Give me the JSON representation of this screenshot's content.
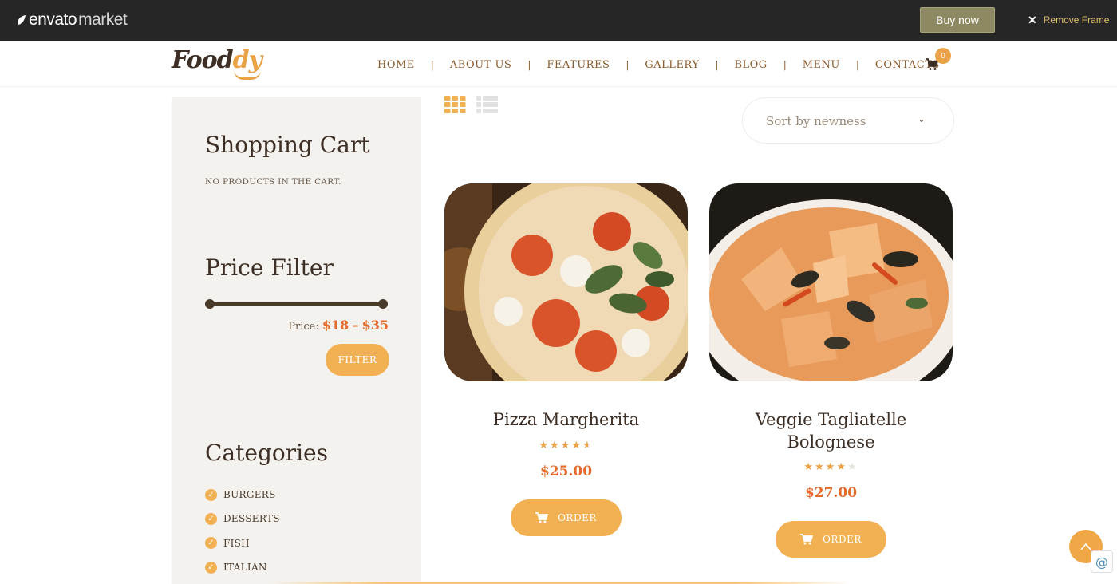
{
  "envato": {
    "brand": "envato",
    "brand_suffix": "market",
    "buy_now": "Buy now",
    "remove_frame": "Remove Frame"
  },
  "header": {
    "logo_text_a": "Food",
    "logo_text_b": "dy",
    "nav": [
      "HOME",
      "ABOUT US",
      "FEATURES",
      "GALLERY",
      "BLOG",
      "MENU",
      "CONTACTS"
    ],
    "nav_separator": "|",
    "cart_count": "0"
  },
  "sidebar": {
    "cart_title": "Shopping Cart",
    "cart_empty": "NO PRODUCTS IN THE CART.",
    "price_filter_title": "Price Filter",
    "price_label": "Price:",
    "price_min": "$18",
    "price_dash": "–",
    "price_max": "$35",
    "filter_button": "FILTER",
    "categories_title": "Categories",
    "categories": [
      "BURGERS",
      "DESSERTS",
      "FISH",
      "ITALIAN"
    ]
  },
  "toolbar": {
    "sort_label": "Sort by newness"
  },
  "products": [
    {
      "title_line1": "Pizza Margherita",
      "title_line2": "",
      "rating": 4.5,
      "price": "$25.00",
      "button": "ORDER"
    },
    {
      "title_line1": "Veggie Tagliatelle",
      "title_line2": "Bolognese",
      "rating": 4,
      "price": "$27.00",
      "button": "ORDER"
    }
  ],
  "colors": {
    "accent": "#f1b152",
    "price": "#e36a2a",
    "text_dark": "#3d2f25",
    "nav": "#8a5a2b",
    "envato_bar": "#262626",
    "buy_now": "#8d8a63"
  },
  "icons": {
    "grid_view": "grid-view-icon",
    "list_view": "list-view-icon",
    "cart": "cart-icon",
    "scroll_top": "arrow-up-icon",
    "check": "check-circle-icon"
  }
}
